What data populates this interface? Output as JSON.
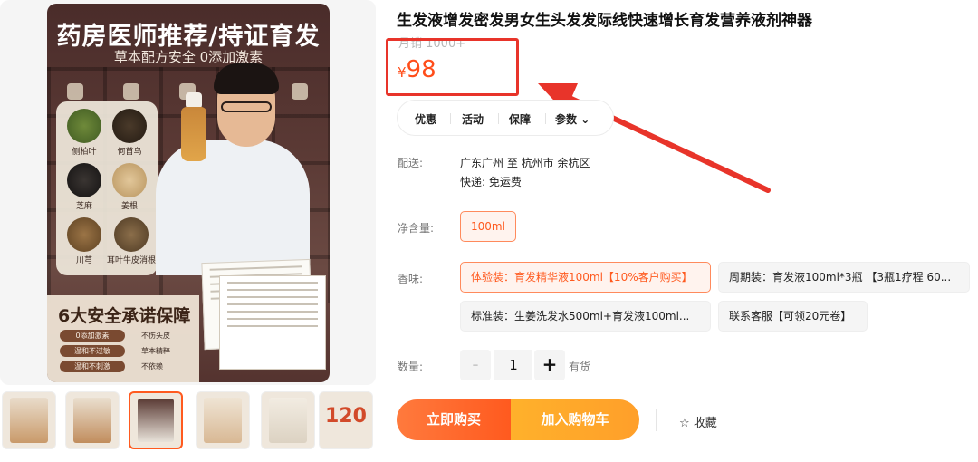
{
  "gallery": {
    "main_image": {
      "headline": "药房医师推荐/持证育发",
      "subheadline": "草本配方安全 0添加激素",
      "herbs": [
        "侧柏叶",
        "何首乌",
        "芝麻",
        "姜根",
        "川芎",
        "耳叶牛皮消根"
      ],
      "promise_title": "6大安全承诺保障",
      "promises": [
        "0添加激素",
        "不伤头皮",
        "温和不过敏",
        "草本精粹",
        "温和不刺激",
        "不依赖"
      ]
    },
    "thumbnails": [
      {
        "id": "thumb-1",
        "color": "#e9dccb"
      },
      {
        "id": "thumb-2",
        "color": "#eadfcf"
      },
      {
        "id": "thumb-3",
        "color": "#5a3a34",
        "active": true
      },
      {
        "id": "thumb-4",
        "color": "#efe4d4"
      },
      {
        "id": "thumb-5",
        "color": "#f2ece2"
      },
      {
        "id": "thumb-6",
        "color": "#f6efe6",
        "number": "120"
      }
    ]
  },
  "product": {
    "title": "生发液增发密发男女生头发发际线快速增长育发营养液剂神器",
    "sales": "月销 1000+",
    "currency": "¥",
    "price": "98"
  },
  "tabs": [
    "优惠",
    "活动",
    "保障",
    "参数"
  ],
  "delivery": {
    "label": "配送:",
    "route": "广东广州 至 杭州市 余杭区",
    "fee": "快递: 免运费"
  },
  "net_content": {
    "label": "净含量:",
    "options": [
      "100ml"
    ]
  },
  "scent": {
    "label": "香味:",
    "options": [
      "体验装：育发精华液100ml【10%客户购买】",
      "周期装：育发液100ml*3瓶 【3瓶1疗程 60...",
      "标准装：生姜洗发水500ml+育发液100ml...",
      "联系客服【可领20元卷】"
    ]
  },
  "quantity": {
    "label": "数量:",
    "minus": "-",
    "value": "1",
    "plus": "+",
    "stock": "有货"
  },
  "actions": {
    "buy_now": "立即购买",
    "add_to_cart": "加入购物车",
    "favorite": "☆ 收藏"
  },
  "colors": {
    "accent": "#ff5a1f",
    "annotation": "#e8342a"
  }
}
